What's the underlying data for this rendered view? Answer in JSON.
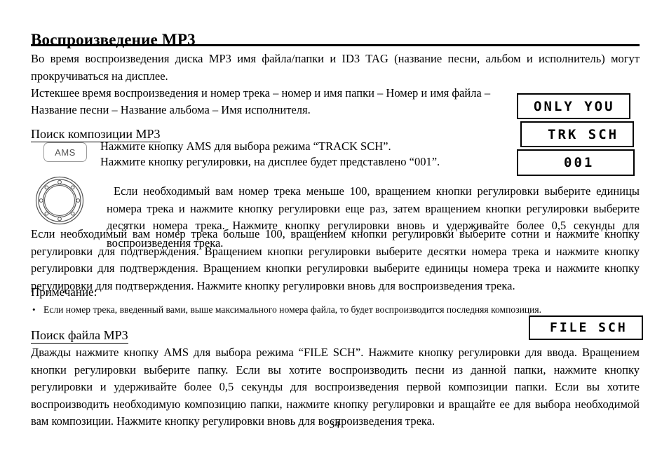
{
  "document": {
    "title": "Воспроизведение MP3",
    "page_number": "34"
  },
  "intro": {
    "paragraph_1": "Во время воспроизведения диска MP3 имя файла/папки и ID3 TAG (название песни, альбом и исполнитель) могут прокручиваться на дисплее.",
    "paragraph_2_line_1": "Истекшее время воспроизведения и номер трека – номер и имя папки – Номер и имя файла –",
    "paragraph_2_line_2": "Название песни – Название альбома – Имя исполнителя."
  },
  "track_search": {
    "heading": "Поиск композиции MP3",
    "ams_button_label": "AMS",
    "step_1": "Нажмите кнопку AMS для выбора режима “TRACK SCH”.",
    "step_2": "Нажмите кнопку регулировки, на дисплее будет представлено “001”.",
    "knob_paragraph": "Если необходимый вам номер трека меньше 100, вращением кнопки регулировки выберите единицы номера трека и нажмите кнопку регулировки еще раз, затем вращением кнопки регулировки выберите десятки номера трека. Нажмите кнопку регулировки вновь и удерживайте более 0,5 секунды для воспроизведения трека.",
    "over_100_paragraph": "Если необходимый вам номер трека больше 100, вращением кнопки регулировки выберите сотни и нажмите кнопку регулировки для подтверждения. Вращением кнопки регулировки выберите десятки номера трека и нажмите кнопку регулировки для подтверждения. Вращением кнопки регулировки выберите единицы номера трека и нажмите кнопку регулировки для подтверждения. Нажмите кнопку регулировки вновь для воспроизведения трека."
  },
  "note": {
    "label": "Примечание:",
    "bullet_glyph": "•",
    "text": "Если номер трека, введенный вами, выше максимального номера файла, то будет воспроизводится последняя композиция."
  },
  "file_search": {
    "heading": "Поиск файла MP3",
    "paragraph": "Дважды нажмите кнопку AMS для выбора режима “FILE SCH”. Нажмите кнопку регулировки для ввода. Вращением кнопки регулировки выберите папку. Если вы хотите воспроизводить песни из данной папки, нажмите кнопку регулировки и удерживайте более 0,5 секунды для воспроизведения первой композиции папки. Если вы хотите воспроизводить необходимую композицию папки, нажмите кнопку регулировки и вращайте ее для выбора необходимой вам композиции. Нажмите кнопку регулировки вновь для воспроизведения трека."
  },
  "displays": [
    {
      "name": "song-title-display",
      "text": "ONLY YOU"
    },
    {
      "name": "track-search-mode-display",
      "text": "TRK SCH"
    },
    {
      "name": "track-number-display",
      "text": "001"
    },
    {
      "name": "file-search-mode-display",
      "text": "FILE SCH"
    }
  ],
  "colors": {
    "text": "#000000",
    "background": "#ffffff",
    "button_border": "#9a9a9a",
    "button_text": "#555555",
    "knob_line": "#555555"
  }
}
